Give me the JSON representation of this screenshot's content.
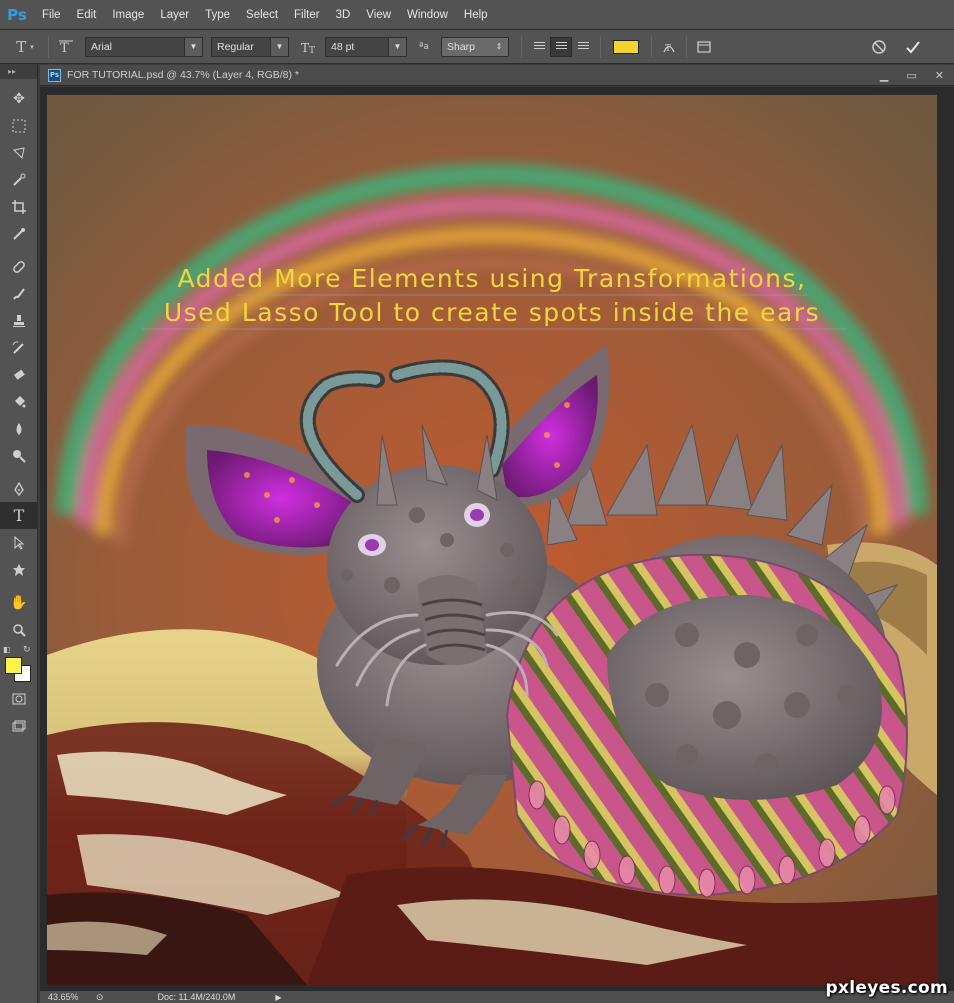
{
  "app": {
    "logo": "Ps"
  },
  "menu": [
    "File",
    "Edit",
    "Image",
    "Layer",
    "Type",
    "Select",
    "Filter",
    "3D",
    "View",
    "Window",
    "Help"
  ],
  "options": {
    "font_family": "Arial",
    "font_style": "Regular",
    "font_size": "48 pt",
    "antialias": "Sharp",
    "text_color": "#f3d42c"
  },
  "document": {
    "title": "FOR TUTORIAL.psd @ 43.7% (Layer 4, RGB/8) *",
    "caption_line1": "Added More Elements using Transformations,",
    "caption_line2": "Used Lasso Tool to create spots inside the ears"
  },
  "status": {
    "zoom": "43.65%",
    "doc_size": "Doc: 11.4M/240.0M"
  },
  "colors": {
    "foreground": "#fff24a",
    "background": "#ffffff",
    "caption": "#f2d640"
  },
  "watermark": "pxleyes.com"
}
